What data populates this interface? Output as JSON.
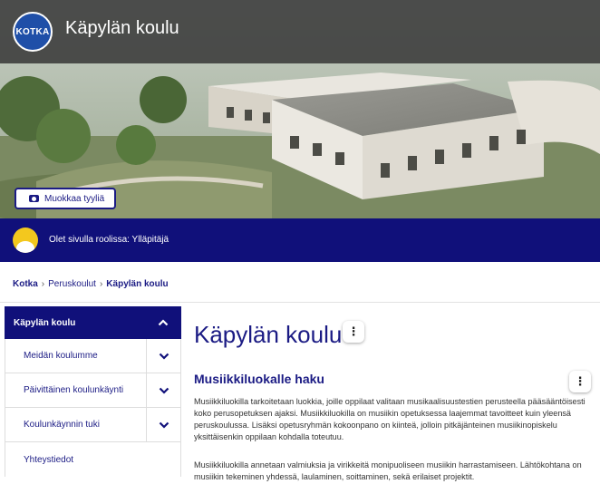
{
  "header": {
    "logo_text": "KOTKA",
    "site_title": "Käpylän koulu",
    "edit_style_label": "Muokkaa tyyliä"
  },
  "role_bar": {
    "text": "Olet sivulla roolissa: Ylläpitäjä"
  },
  "breadcrumb": {
    "items": [
      "Kotka",
      "Peruskoulut",
      "Käpylän koulu"
    ]
  },
  "sidebar": {
    "header": "Käpylän koulu",
    "items": [
      {
        "label": "Meidän koulumme"
      },
      {
        "label": "Päivittäinen koulunkäynti"
      },
      {
        "label": "Koulunkäynnin tuki"
      },
      {
        "label": "Yhteystiedot"
      }
    ]
  },
  "main": {
    "title": "Käpylän koulu",
    "section_title": "Musiikkiluokalle haku",
    "paragraph1": "Musiikkiluokilla tarkoitetaan luokkia, joille oppilaat valitaan musikaalisuustestien perusteella pääsääntöisesti koko perusopetuksen ajaksi. Musiikkiluokilla on musiikin opetuksessa laajemmat tavoitteet kuin yleensä peruskoulussa. Lisäksi opetusryhmän kokoonpano on kiinteä, jolloin pitkäjänteinen musiikinopiskelu yksittäisenkin oppilaan kohdalla toteutuu.",
    "paragraph2": "Musiikkiluokilla annetaan valmiuksia ja virikkeitä monipuoliseen musiikin harrastamiseen. Lähtökohtana on musiikin tekeminen yhdessä, laulaminen, soittaminen, sekä erilaiset projektit."
  },
  "colors": {
    "brand_navy": "#10107a",
    "link_blue": "#1b1b84",
    "logo_blue": "#1f4fa8"
  }
}
